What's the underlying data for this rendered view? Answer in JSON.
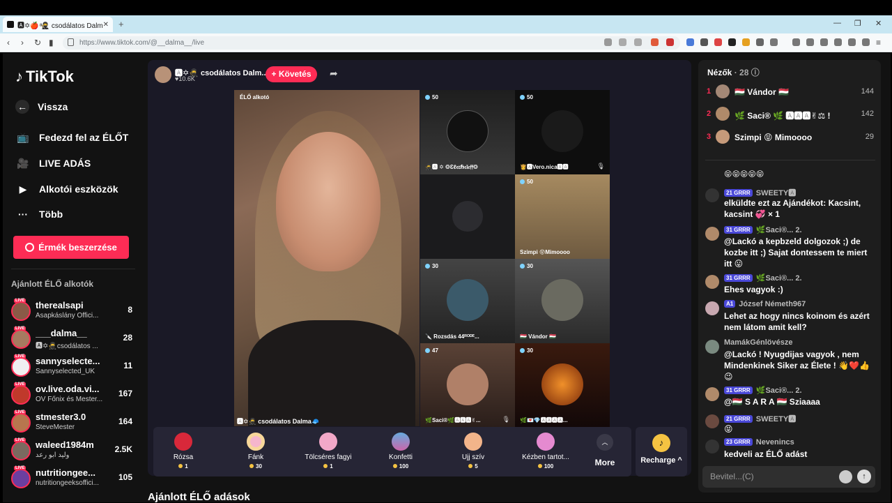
{
  "browser": {
    "tab_title": "🅰✡🍎 ͣ🥷 csodálatos Dalma🧢",
    "close": "✕",
    "new_tab": "+",
    "url": "https://www.tiktok.com/@__dalma__/live"
  },
  "sidebar": {
    "logo": "TikTok",
    "back": "Vissza",
    "items": [
      {
        "label": "Fedezd fel az ÉLŐT",
        "icon": "tv-icon"
      },
      {
        "label": "LIVE ADÁS",
        "icon": "camera-icon"
      },
      {
        "label": "Alkotói eszközök",
        "icon": "play-icon"
      },
      {
        "label": "Több",
        "icon": "more-icon"
      }
    ],
    "coins_button": "Érmék beszerzése",
    "recommended_title": "Ajánlott ÉLŐ alkotók",
    "live_badge": "LIVE",
    "recommended": [
      {
        "name": "therealsapi",
        "sub": "Asapkáslány Offici...",
        "count": "8"
      },
      {
        "name": "___dalma__",
        "sub": "🅰✡🥷csodálatos ...",
        "count": "28"
      },
      {
        "name": "sannyselecte...",
        "sub": "Sannyselected_UK",
        "count": "11"
      },
      {
        "name": "ov.live.oda.vi...",
        "sub": "OV Főnix és Mester...",
        "count": "167"
      },
      {
        "name": "stmester3.0",
        "sub": "SteveMester",
        "count": "164"
      },
      {
        "name": "waleed1984m",
        "sub": "وليد ابو رعد",
        "count": "2.5K"
      },
      {
        "name": "nutritiongee...",
        "sub": "nutritiongeeksoffici...",
        "count": "105"
      }
    ]
  },
  "stream": {
    "host_name": "🅰✡🥷 csodálatos Dalm...",
    "host_likes": "♥10.6K",
    "follow": "+ Követés",
    "main_label": "ÉLŐ alkotó",
    "main_name": "🅰✡🥷 csodálatos Dalma🧢",
    "tiles": [
      {
        "score": "50",
        "name": "🥷🅰 ✡ ❂Ɛℓ𝔢𝔯ℏ𝔢𝔩𝔢𝔣𝔣❂"
      },
      {
        "score": "50",
        "name": "👸🅰Vero.nica🅰🅰"
      },
      {
        "score": "",
        "name": ""
      },
      {
        "score": "50",
        "name": "Szimpi 😝Mimoooo"
      },
      {
        "score": "30",
        "name": "🔪 Rozsdás 44ᴿᴼᴰᴱ..."
      },
      {
        "score": "30",
        "name": "🇭🇺 Vándor 🇭🇺"
      },
      {
        "score": "47",
        "name": "🌿Saci®🌿🅰🅰🅰✌..."
      },
      {
        "score": "30",
        "name": "🌿💌💎🅰🅰🅰🅰..."
      }
    ],
    "gifts": [
      {
        "name": "Rózsa",
        "price": "1"
      },
      {
        "name": "Fánk",
        "price": "30"
      },
      {
        "name": "Tölcséres fagyi",
        "price": "1"
      },
      {
        "name": "Konfetti",
        "price": "100"
      },
      {
        "name": "Ujj szív",
        "price": "5"
      },
      {
        "name": "Kézben tartot...",
        "price": "100"
      }
    ],
    "more": "More",
    "recharge": "Recharge ^",
    "recommended_live_title": "Ajánlott ÉLŐ adások"
  },
  "panel": {
    "viewers_label": "Nézők",
    "viewers_count": "· 28",
    "viewers": [
      {
        "rank": "1",
        "name": "🇭🇺 Vándor 🇭🇺",
        "score": "144"
      },
      {
        "rank": "2",
        "name": "🌿 Saci® 🌿 🅰🅰🅰✌⚖ !",
        "score": "142"
      },
      {
        "rank": "3",
        "name": "Szimpi 😝 Mimoooo",
        "score": "29"
      }
    ],
    "chat": [
      {
        "head": "",
        "user": "",
        "text": "😝😝😝😝😝"
      },
      {
        "head": "21 GRRR",
        "user": "SWEETY🅰",
        "text": "elküldte ezt az Ajándékot: Kacsint, kacsint 💞 × 1"
      },
      {
        "head": "31 GRRR",
        "user": "🌿Saci®... 2.",
        "text": "@Lackó a kepbzeld dolgozok ;) de kozbe itt ;) Sajat dontessem te miert itt 😛"
      },
      {
        "head": "31 GRRR",
        "user": "🌿Saci®... 2.",
        "text": "Ehes vagyok :)"
      },
      {
        "head": "A1",
        "user": "József Németh967",
        "text": "Lehet az hogy nincs koinom és azért nem látom amit kell?"
      },
      {
        "head": "",
        "user": "MamákGénlövésze",
        "text": "@Lackó ! Nyugdijas vagyok , nem Mindenkinek Siker az Élete ! 👋❤️👍😉"
      },
      {
        "head": "31 GRRR",
        "user": "🌿Saci®... 2.",
        "text": "@🇭🇺 S A R A 🇭🇺 Sziaaaa"
      },
      {
        "head": "21 GRRR",
        "user": "SWEETY🅰",
        "text": "😝"
      },
      {
        "head": "23 GRRR",
        "user": "Nevenincs",
        "text": "kedveli az ÉLŐ adást"
      }
    ],
    "input_placeholder": "Bevitel...(C)"
  },
  "colors": {
    "accent": "#fe2c55",
    "panel": "#1d1d1d",
    "page": "#121212",
    "coin": "#f5c342"
  }
}
